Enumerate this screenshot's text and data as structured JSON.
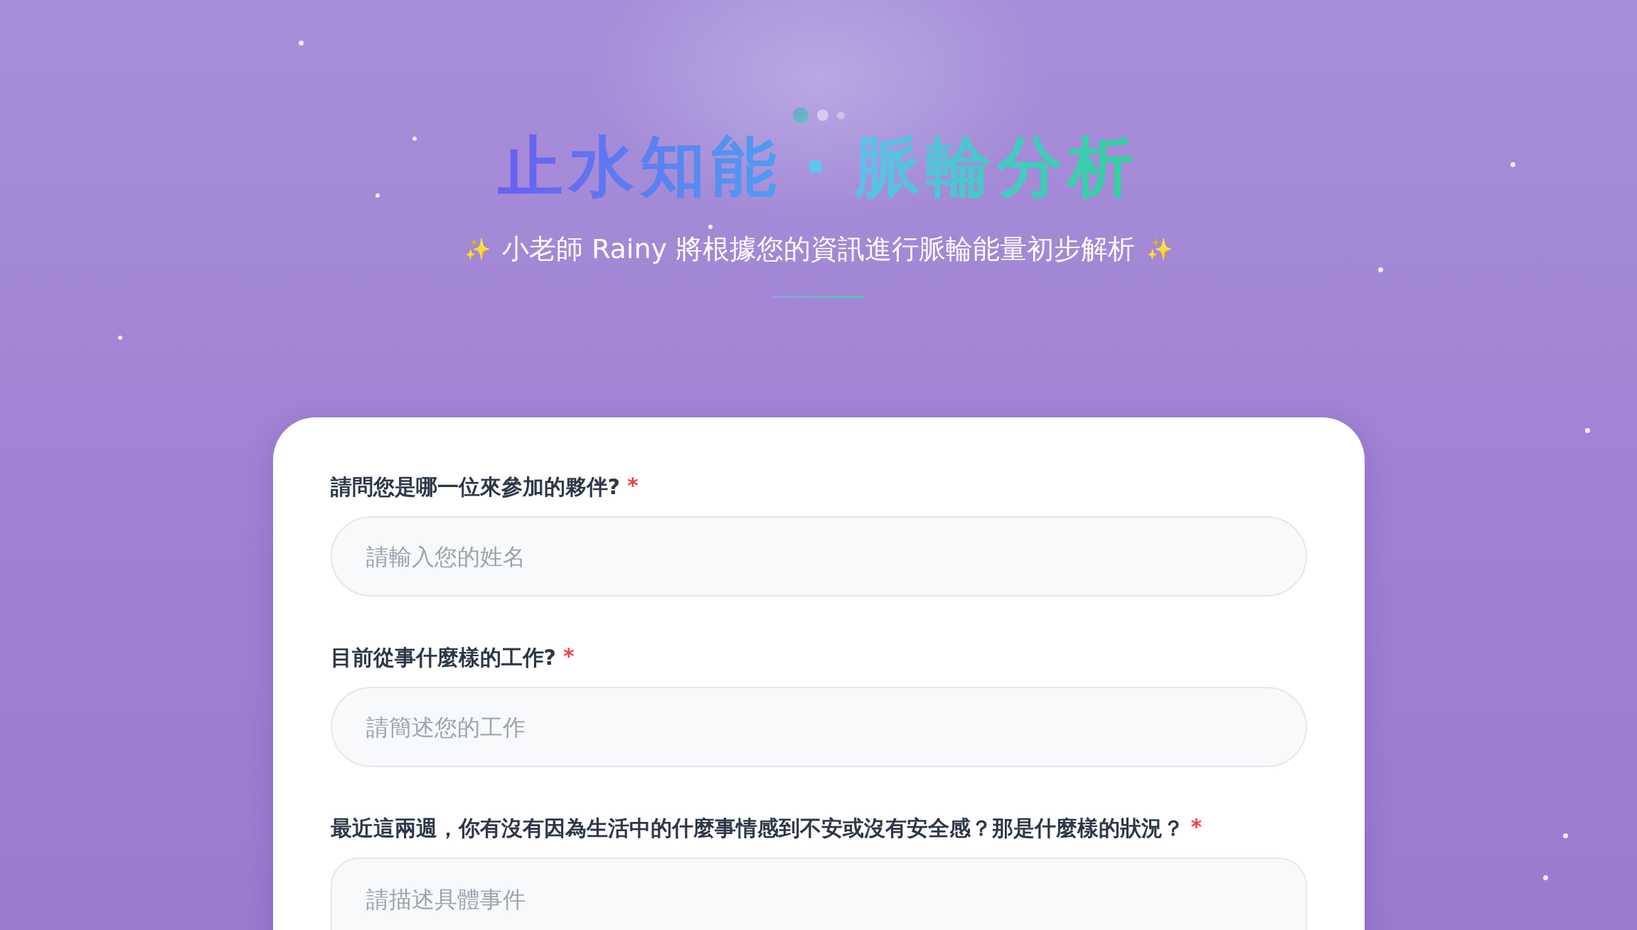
{
  "header": {
    "title_left": "止水知能",
    "title_separator": "·",
    "title_right": "脈輪分析",
    "subtitle_sparkle_left": "✨",
    "subtitle": "小老師 Rainy 將根據您的資訊進行脈輪能量初步解析",
    "subtitle_sparkle_right": "✨"
  },
  "form": {
    "fields": [
      {
        "kind": "input",
        "label": "請問您是哪一位來參加的夥伴?",
        "required_mark": "*",
        "placeholder": "請輸入您的姓名"
      },
      {
        "kind": "input",
        "label": "目前從事什麼樣的工作?",
        "required_mark": "*",
        "placeholder": "請簡述您的工作"
      },
      {
        "kind": "textarea",
        "label": "最近這兩週，你有沒有因為生活中的什麼事情感到不安或沒有安全感？那是什麼樣的狀況？",
        "required_mark": "*",
        "placeholder": "請描述具體事件"
      }
    ]
  }
}
